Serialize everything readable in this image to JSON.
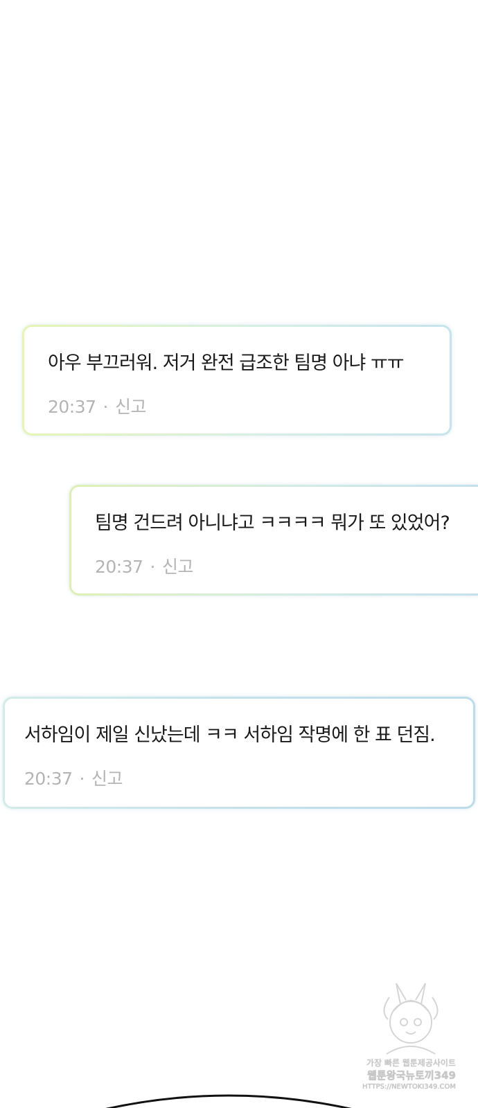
{
  "messages": [
    {
      "text": "아우 부끄러워. 저거 완전 급조한 팀명 아냐 ㅠㅠ",
      "time": "20:37",
      "separator": "·",
      "report_label": "신고"
    },
    {
      "text": "팀명 건드려 아니냐고 ㅋㅋㅋㅋ 뭐가 또 있었어?",
      "time": "20:37",
      "separator": "·",
      "report_label": "신고"
    },
    {
      "text": "서하임이 제일 신났는데 ㅋㅋ 서하임 작명에 한 표 던짐.",
      "time": "20:37",
      "separator": "·",
      "report_label": "신고"
    }
  ],
  "watermark": {
    "line1": "가장 빠른 웹툰제공사이트",
    "line2": "웹툰왕국뉴토끼349",
    "line3": "HTTPS://NEWTOKI349.COM"
  },
  "colors": {
    "background": "#ffffff",
    "text": "#1a1a1a",
    "meta_text": "#b4b4b4",
    "border_yellow_green": "#e6f5b4",
    "border_light_blue": "#c4e0ec"
  }
}
